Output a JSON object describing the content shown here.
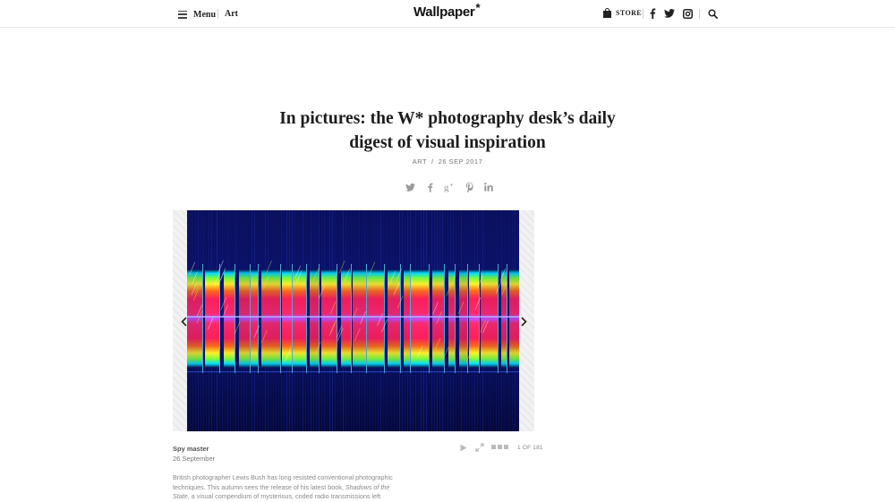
{
  "header": {
    "menu_label": "Menu",
    "section_label": "Art",
    "logo_text": "Wallpaper",
    "logo_mark": "*",
    "store_label": "STORE",
    "icons": [
      "shopping-bag-icon",
      "facebook-icon",
      "twitter-icon",
      "instagram-icon",
      "search-icon"
    ]
  },
  "article": {
    "title": "In pictures: the W* photography desk’s daily digest of visual inspiration",
    "category": "ART",
    "separator": "/",
    "date": "26 SEP 2017",
    "share_icons": [
      "twitter-icon",
      "facebook-icon",
      "google-plus-icon",
      "pinterest-icon",
      "linkedin-icon"
    ]
  },
  "gallery": {
    "image_subject": "radio spectrogram",
    "caption_title": "Spy master",
    "caption_date": "26 September",
    "counter": "1 OF 181",
    "controls": [
      "play-icon",
      "fullscreen-icon",
      "grid-view-icon"
    ]
  },
  "body": {
    "text_before": "British photographer Lewis Bush has long resisted conventional photographic techniques. This autumn sees the release of his latest book, ",
    "book_title": "Shadows of the State",
    "text_after": ", a visual compendium of mysterious, coded radio transmissions left"
  },
  "colors": {
    "text": "#222222",
    "meta": "#777777",
    "spectrogram_background": "#0a0d4a"
  }
}
